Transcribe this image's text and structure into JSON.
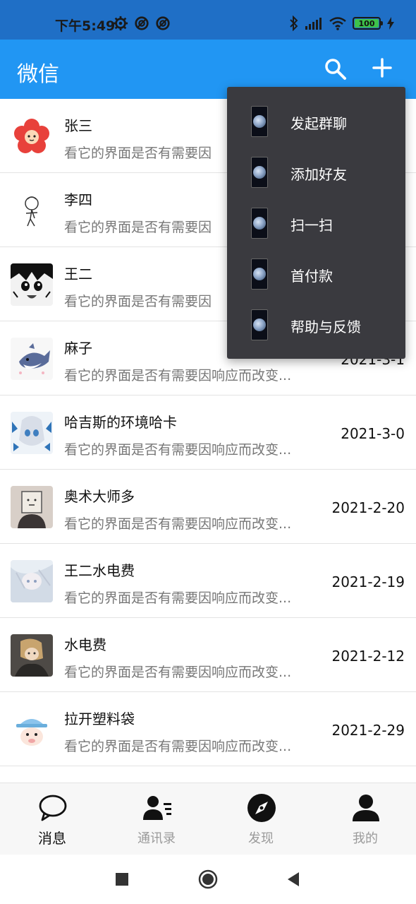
{
  "status_bar": {
    "time": "下午5:49",
    "battery": "100",
    "icons": [
      "gear-icon",
      "status-app-icon",
      "status-app-icon",
      "bluetooth-icon",
      "signal-icon",
      "wifi-icon",
      "battery-icon",
      "charging-icon"
    ]
  },
  "app_bar": {
    "title": "微信",
    "icons": [
      "search-icon",
      "plus-icon"
    ]
  },
  "chats": [
    {
      "name": "张三",
      "preview": "看它的界面是否有需要因",
      "date": ""
    },
    {
      "name": "李四",
      "preview": "看它的界面是否有需要因",
      "date": ""
    },
    {
      "name": "王二",
      "preview": "看它的界面是否有需要因",
      "date": ""
    },
    {
      "name": "麻子",
      "preview": "看它的界面是否有需要因响应而改变...",
      "date": "2021-3-1"
    },
    {
      "name": "哈吉斯的环境哈卡",
      "preview": "看它的界面是否有需要因响应而改变...",
      "date": "2021-3-0"
    },
    {
      "name": "奥术大师多",
      "preview": "看它的界面是否有需要因响应而改变...",
      "date": "2021-2-20"
    },
    {
      "name": "王二水电费",
      "preview": "看它的界面是否有需要因响应而改变...",
      "date": "2021-2-19"
    },
    {
      "name": "水电费",
      "preview": "看它的界面是否有需要因响应而改变...",
      "date": "2021-2-12"
    },
    {
      "name": "拉开塑料袋",
      "preview": "看它的界面是否有需要因响应而改变...",
      "date": "2021-2-29"
    }
  ],
  "popup_menu": {
    "items": [
      {
        "label": "发起群聊",
        "icon": "moon-icon"
      },
      {
        "label": "添加好友",
        "icon": "moon-icon"
      },
      {
        "label": "扫一扫",
        "icon": "moon-icon"
      },
      {
        "label": "首付款",
        "icon": "moon-icon"
      },
      {
        "label": "帮助与反馈",
        "icon": "moon-icon"
      }
    ]
  },
  "bottom_nav": {
    "items": [
      {
        "label": "消息",
        "icon": "chat-bubble-icon",
        "active": true
      },
      {
        "label": "通讯录",
        "icon": "contacts-icon",
        "active": false
      },
      {
        "label": "发现",
        "icon": "compass-icon",
        "active": false
      },
      {
        "label": "我的",
        "icon": "person-icon",
        "active": false
      }
    ]
  },
  "colors": {
    "status_bar": "#1f6fc6",
    "app_bar": "#2196f3",
    "popup_bg": "#3a3a3f",
    "active_nav": "#111111",
    "inactive_nav": "#9a9a9a",
    "battery_fill": "#3ec24a"
  }
}
